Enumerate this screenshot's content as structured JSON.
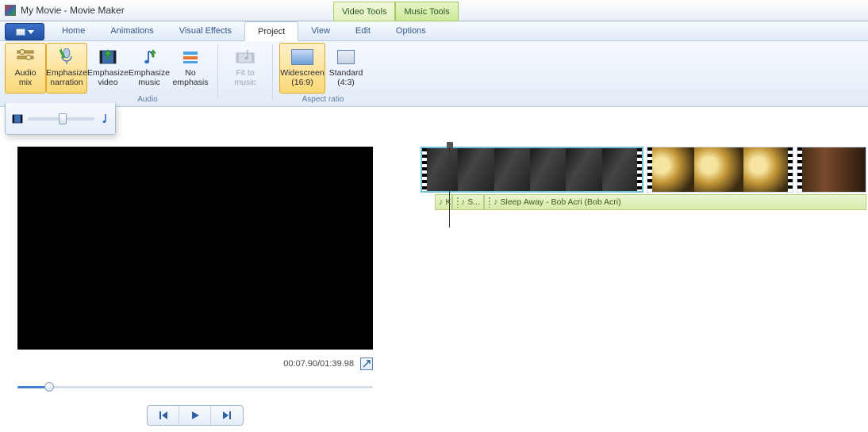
{
  "window": {
    "title": "My Movie - Movie Maker"
  },
  "context_tabs": {
    "video": "Video Tools",
    "music": "Music Tools"
  },
  "tabs": {
    "home": "Home",
    "animations": "Animations",
    "visual_effects": "Visual Effects",
    "project": "Project",
    "view": "View",
    "edit": "Edit",
    "options": "Options"
  },
  "ribbon": {
    "audio_mix": {
      "l1": "Audio",
      "l2": "mix"
    },
    "emph_narr": {
      "l1": "Emphasize",
      "l2": "narration"
    },
    "emph_video": {
      "l1": "Emphasize",
      "l2": "video"
    },
    "emph_music": {
      "l1": "Emphasize",
      "l2": "music"
    },
    "no_emph": {
      "l1": "No",
      "l2": "emphasis"
    },
    "fit_music": {
      "l1": "Fit to",
      "l2": "music"
    },
    "widescreen": {
      "l1": "Widescreen",
      "l2": "(16:9)"
    },
    "standard": {
      "l1": "Standard",
      "l2": "(4:3)"
    },
    "group_audio": "Audio",
    "group_aspect": "Aspect ratio"
  },
  "preview": {
    "time": "00:07.90/01:39.98"
  },
  "timeline": {
    "audio_clips": {
      "a": "K",
      "b": "S...",
      "c": "Sleep Away - Bob Acri (Bob Acri)"
    }
  }
}
